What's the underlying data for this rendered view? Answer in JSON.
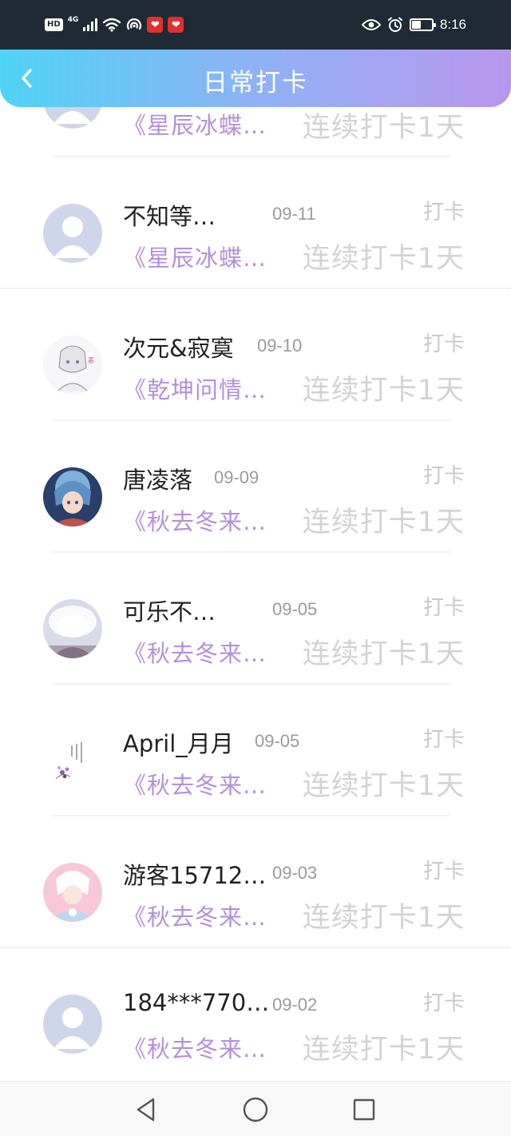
{
  "status_bar": {
    "hd_label": "HD",
    "network_label": "4G",
    "time": "8:16",
    "icons": [
      "hd-icon",
      "signal-icon",
      "wifi-icon",
      "hotspot-icon",
      "app-notification-icon",
      "app-notification-icon",
      "eye-icon",
      "alarm-icon",
      "battery-icon"
    ],
    "battery_level": 0.45
  },
  "header": {
    "back_icon": "chevron-left-icon",
    "title": "日常打卡",
    "gradient": [
      "#4fd3f6",
      "#b996ee"
    ]
  },
  "colors": {
    "book_title": "#b490d8",
    "streak_text": "#d3d3d3",
    "name_text": "#222222",
    "date_text": "#9a9a9a"
  },
  "list": {
    "partial_row": {
      "book": "《星辰冰蝶…",
      "streak": "连续打卡1天"
    },
    "items": [
      {
        "name": "不知等…",
        "date": "09-11",
        "action": "打卡",
        "book": "《星辰冰蝶…",
        "streak": "连续打卡1天",
        "avatar": "default-avatar"
      },
      {
        "name": "次元&寂寞",
        "date": "09-10",
        "action": "打卡",
        "book": "《乾坤问情…",
        "streak": "连续打卡1天",
        "avatar": "anime-sketch-avatar"
      },
      {
        "name": "唐凌落",
        "date": "09-09",
        "action": "打卡",
        "book": "《秋去冬来…",
        "streak": "连续打卡1天",
        "avatar": "anime-girl-avatar"
      },
      {
        "name": "可乐不…",
        "date": "09-05",
        "action": "打卡",
        "book": "《秋去冬来…",
        "streak": "连续打卡1天",
        "avatar": "white-hat-avatar"
      },
      {
        "name": "April_月月",
        "date": "09-05",
        "action": "打卡",
        "book": "《秋去冬来…",
        "streak": "连续打卡1天",
        "avatar": "calligraphy-avatar"
      },
      {
        "name": "游客15712…",
        "date": "09-03",
        "action": "打卡",
        "book": "《秋去冬来…",
        "streak": "连续打卡1天",
        "avatar": "pink-anime-avatar"
      },
      {
        "name": "184***770…",
        "date": "09-02",
        "action": "打卡",
        "book": "《秋去冬来…",
        "streak": "连续打卡1天",
        "avatar": "default-avatar"
      }
    ]
  },
  "nav_bar": {
    "icons": [
      "back-triangle-icon",
      "home-circle-icon",
      "recents-square-icon"
    ]
  }
}
